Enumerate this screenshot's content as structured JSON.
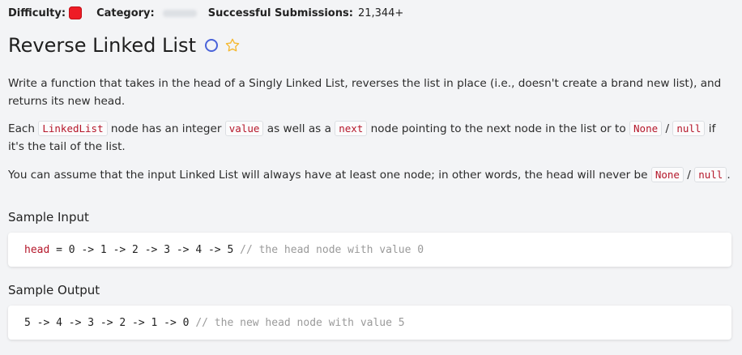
{
  "meta": {
    "difficulty_label": "Difficulty:",
    "category_label": "Category:",
    "submissions_label": "Successful Submissions:",
    "submissions_value": "21,344+",
    "difficulty_color": "#ee1c25"
  },
  "title": "Reverse Linked List",
  "icons": {
    "status": "circle-outline-icon",
    "favorite": "star-outline-icon",
    "star_color": "#f5b82e",
    "circle_color": "#4a63d9"
  },
  "description": {
    "p1": "Write a function that takes in the head of a Singly Linked List, reverses the list in place (i.e., doesn't create a brand new list), and returns its new head.",
    "p2": {
      "t1": "Each ",
      "c1": "LinkedList",
      "t2": " node has an integer ",
      "c2": "value",
      "t3": " as well as a ",
      "c3": "next",
      "t4": " node pointing to the next node in the list or to ",
      "c4": "None",
      "t5": " / ",
      "c5": "null",
      "t6": " if it's the tail of the list."
    },
    "p3": {
      "t1": "You can assume that the input Linked List will always have at least one node; in other words, the head will never be ",
      "c1": "None",
      "t2": " / ",
      "c2": "null",
      "t3": "."
    }
  },
  "sample_input": {
    "title": "Sample Input",
    "var": "head",
    "code": " = 0 -> 1 -> 2 -> 3 -> 4 -> 5 ",
    "comment": "// the head node with value 0"
  },
  "sample_output": {
    "title": "Sample Output",
    "code": "5 -> 4 -> 3 -> 2 -> 1 -> 0 ",
    "comment": "// the new head node with value 5"
  }
}
